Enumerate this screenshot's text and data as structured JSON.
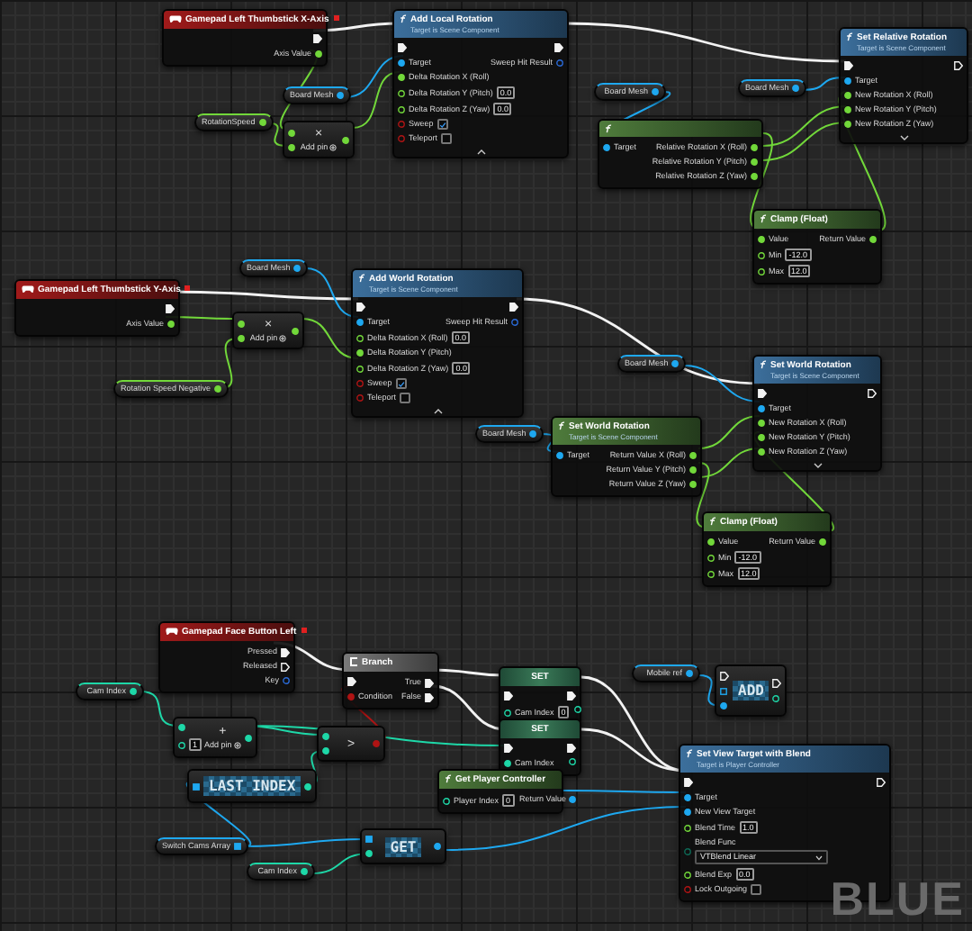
{
  "nodes": [
    {
      "kind": "event",
      "title": "Gamepad Left Thumbstick X-Axis",
      "outputs": [
        {
          "kind": "exec",
          "linked": true
        },
        {
          "kind": "float",
          "label": "Axis Value",
          "linked": true
        }
      ]
    },
    {
      "kind": "variable",
      "title": "Board Mesh",
      "outputs": [
        {
          "kind": "object",
          "linked": true
        }
      ]
    },
    {
      "kind": "variable",
      "title": "RotationSpeed",
      "outputs": [
        {
          "kind": "float",
          "linked": true
        }
      ]
    },
    {
      "kind": "operator",
      "symbol": "×",
      "add_pin": "Add pin",
      "inputs": [
        {
          "kind": "float",
          "linked": true
        },
        {
          "kind": "float",
          "linked": true
        }
      ],
      "outputs": [
        {
          "kind": "float",
          "linked": true
        }
      ]
    },
    {
      "kind": "function",
      "title": "Add Local Rotation",
      "subtitle": "Target is Scene Component",
      "expanded": true,
      "inputs": [
        {
          "kind": "exec",
          "linked": true
        },
        {
          "kind": "object",
          "label": "Target",
          "linked": true
        },
        {
          "kind": "float",
          "label": "Delta Rotation X (Roll)",
          "linked": true
        },
        {
          "kind": "float",
          "label": "Delta Rotation Y (Pitch)",
          "linked": false,
          "value": "0.0"
        },
        {
          "kind": "float",
          "label": "Delta Rotation Z (Yaw)",
          "linked": false,
          "value": "0.0"
        },
        {
          "kind": "bool",
          "label": "Sweep",
          "linked": false,
          "checked": true
        },
        {
          "kind": "bool",
          "label": "Teleport",
          "linked": false,
          "checked": false
        }
      ],
      "outputs": [
        {
          "kind": "exec",
          "linked": true
        },
        {
          "kind": "struct",
          "label": "Sweep Hit Result",
          "linked": false
        }
      ]
    },
    {
      "kind": "variable",
      "title": "Board Mesh",
      "outputs": [
        {
          "kind": "object",
          "linked": true
        }
      ]
    },
    {
      "kind": "variable",
      "title": "Board Mesh",
      "outputs": [
        {
          "kind": "object",
          "linked": true
        }
      ]
    },
    {
      "kind": "pure",
      "inputs": [
        {
          "kind": "object",
          "label": "Target",
          "linked": true
        }
      ],
      "outputs": [
        {
          "kind": "float",
          "label": "Relative Rotation X (Roll)",
          "linked": true
        },
        {
          "kind": "float",
          "label": "Relative Rotation Y (Pitch)",
          "linked": true
        },
        {
          "kind": "float",
          "label": "Relative Rotation Z (Yaw)",
          "linked": true
        }
      ]
    },
    {
      "kind": "function",
      "title": "Set Relative Rotation",
      "subtitle": "Target is Scene Component",
      "expanded": false,
      "inputs": [
        {
          "kind": "exec",
          "linked": true
        },
        {
          "kind": "object",
          "label": "Target",
          "linked": true
        },
        {
          "kind": "float",
          "label": "New Rotation X (Roll)",
          "linked": true
        },
        {
          "kind": "float",
          "label": "New Rotation Y (Pitch)",
          "linked": true
        },
        {
          "kind": "float",
          "label": "New Rotation Z (Yaw)",
          "linked": true
        }
      ],
      "outputs": [
        {
          "kind": "exec",
          "linked": false
        }
      ]
    },
    {
      "kind": "pure",
      "title": "Clamp (Float)",
      "inputs": [
        {
          "kind": "float",
          "label": "Value",
          "linked": true
        },
        {
          "kind": "float",
          "label": "Min",
          "linked": false,
          "value": "-12.0"
        },
        {
          "kind": "float",
          "label": "Max",
          "linked": false,
          "value": "12.0"
        }
      ],
      "outputs": [
        {
          "kind": "float",
          "label": "Return Value",
          "linked": true
        }
      ]
    },
    {
      "kind": "event",
      "title": "Gamepad Left Thumbstick Y-Axis",
      "outputs": [
        {
          "kind": "exec",
          "linked": true
        },
        {
          "kind": "float",
          "label": "Axis Value",
          "linked": true
        }
      ]
    },
    {
      "kind": "variable",
      "title": "Board Mesh",
      "outputs": [
        {
          "kind": "object",
          "linked": true
        }
      ]
    },
    {
      "kind": "operator",
      "symbol": "×",
      "add_pin": "Add pin",
      "inputs": [
        {
          "kind": "float",
          "linked": true
        },
        {
          "kind": "float",
          "linked": true
        }
      ],
      "outputs": [
        {
          "kind": "float",
          "linked": true
        }
      ]
    },
    {
      "kind": "variable",
      "title": "Rotation Speed Negative",
      "outputs": [
        {
          "kind": "float",
          "linked": true
        }
      ]
    },
    {
      "kind": "function",
      "title": "Add World Rotation",
      "subtitle": "Target is Scene Component",
      "expanded": true,
      "inputs": [
        {
          "kind": "exec",
          "linked": true
        },
        {
          "kind": "object",
          "label": "Target",
          "linked": true
        },
        {
          "kind": "float",
          "label": "Delta Rotation X (Roll)",
          "linked": false,
          "value": "0.0"
        },
        {
          "kind": "float",
          "label": "Delta Rotation Y (Pitch)",
          "linked": true
        },
        {
          "kind": "float",
          "label": "Delta Rotation Z (Yaw)",
          "linked": false,
          "value": "0.0"
        },
        {
          "kind": "bool",
          "label": "Sweep",
          "linked": false,
          "checked": true
        },
        {
          "kind": "bool",
          "label": "Teleport",
          "linked": false,
          "checked": false
        }
      ],
      "outputs": [
        {
          "kind": "exec",
          "linked": true
        },
        {
          "kind": "struct",
          "label": "Sweep Hit Result",
          "linked": false
        }
      ]
    },
    {
      "kind": "variable",
      "title": "Board Mesh",
      "outputs": [
        {
          "kind": "object",
          "linked": true
        }
      ]
    },
    {
      "kind": "variable",
      "title": "Board Mesh",
      "outputs": [
        {
          "kind": "object",
          "linked": true
        }
      ]
    },
    {
      "kind": "pure",
      "title": "Set World Rotation",
      "subtitle": "Target is Scene Component",
      "inputs": [
        {
          "kind": "object",
          "label": "Target",
          "linked": true
        }
      ],
      "outputs": [
        {
          "kind": "float",
          "label": "Return Value X (Roll)",
          "linked": true
        },
        {
          "kind": "float",
          "label": "Return Value Y (Pitch)",
          "linked": true
        },
        {
          "kind": "float",
          "label": "Return Value Z (Yaw)",
          "linked": true
        }
      ]
    },
    {
      "kind": "function",
      "title": "Set World Rotation",
      "subtitle": "Target is Scene Component",
      "expanded": false,
      "inputs": [
        {
          "kind": "exec",
          "linked": true
        },
        {
          "kind": "object",
          "label": "Target",
          "linked": true
        },
        {
          "kind": "float",
          "label": "New Rotation X (Roll)",
          "linked": true
        },
        {
          "kind": "float",
          "label": "New Rotation Y (Pitch)",
          "linked": true
        },
        {
          "kind": "float",
          "label": "New Rotation Z (Yaw)",
          "linked": true
        }
      ],
      "outputs": [
        {
          "kind": "exec",
          "linked": false
        }
      ]
    },
    {
      "kind": "pure",
      "title": "Clamp (Float)",
      "inputs": [
        {
          "kind": "float",
          "label": "Value",
          "linked": true
        },
        {
          "kind": "float",
          "label": "Min",
          "linked": false,
          "value": "-12.0"
        },
        {
          "kind": "float",
          "label": "Max",
          "linked": false,
          "value": "12.0"
        }
      ],
      "outputs": [
        {
          "kind": "float",
          "label": "Return Value",
          "linked": true
        }
      ]
    },
    {
      "kind": "event",
      "title": "Gamepad Face Button Left",
      "outputs": [
        {
          "kind": "exec",
          "label": "Pressed",
          "linked": true
        },
        {
          "kind": "exec",
          "label": "Released",
          "linked": false
        },
        {
          "kind": "struct",
          "label": "Key",
          "linked": false
        }
      ]
    },
    {
      "kind": "flow",
      "title": "Branch",
      "inputs": [
        {
          "kind": "exec",
          "linked": true
        },
        {
          "kind": "bool",
          "label": "Condition",
          "linked": true
        }
      ],
      "outputs": [
        {
          "kind": "exec",
          "label": "True",
          "linked": true
        },
        {
          "kind": "exec",
          "label": "False",
          "linked": true
        }
      ]
    },
    {
      "kind": "variable",
      "title": "Cam Index",
      "outputs": [
        {
          "kind": "int",
          "linked": true
        }
      ]
    },
    {
      "kind": "operator",
      "symbol": "+",
      "add_pin": "Add pin",
      "inputs": [
        {
          "kind": "int",
          "linked": true
        },
        {
          "kind": "int",
          "linked": false,
          "value": "1"
        }
      ],
      "outputs": [
        {
          "kind": "int",
          "linked": true
        }
      ]
    },
    {
      "kind": "operator",
      "symbol": ">",
      "inputs": [
        {
          "kind": "int",
          "linked": true
        },
        {
          "kind": "int",
          "linked": true
        }
      ],
      "outputs": [
        {
          "kind": "bool",
          "linked": true
        }
      ]
    },
    {
      "kind": "macro",
      "symbol": "LAST INDEX",
      "inputs": [
        {
          "kind": "array",
          "linked": true
        }
      ],
      "outputs": [
        {
          "kind": "int",
          "linked": true
        }
      ]
    },
    {
      "kind": "variable",
      "title": "Switch Cams Array",
      "outputs": [
        {
          "kind": "array",
          "linked": true
        }
      ]
    },
    {
      "kind": "macro",
      "symbol": "GET",
      "inputs": [
        {
          "kind": "array",
          "linked": true
        },
        {
          "kind": "int",
          "linked": true
        }
      ],
      "outputs": [
        {
          "kind": "object",
          "linked": true
        }
      ]
    },
    {
      "kind": "variable",
      "title": "Cam Index",
      "outputs": [
        {
          "kind": "int",
          "linked": true
        }
      ]
    },
    {
      "kind": "set",
      "title": "SET",
      "inputs": [
        {
          "kind": "exec",
          "linked": true
        },
        {
          "kind": "int",
          "label": "Cam Index",
          "linked": false,
          "value": "0"
        }
      ],
      "outputs": [
        {
          "kind": "exec",
          "linked": true
        },
        {
          "kind": "int",
          "linked": false
        }
      ]
    },
    {
      "kind": "set",
      "title": "SET",
      "inputs": [
        {
          "kind": "exec",
          "linked": true
        },
        {
          "kind": "int",
          "label": "Cam Index",
          "linked": true
        }
      ],
      "outputs": [
        {
          "kind": "exec",
          "linked": true
        },
        {
          "kind": "int",
          "linked": false
        }
      ]
    },
    {
      "kind": "variable",
      "title": "Mobile ref",
      "outputs": [
        {
          "kind": "object",
          "linked": true
        }
      ]
    },
    {
      "kind": "macro",
      "symbol": "ADD",
      "inputs": [
        {
          "kind": "exec",
          "linked": false
        },
        {
          "kind": "array",
          "linked": false
        },
        {
          "kind": "object",
          "linked": true
        }
      ],
      "outputs": [
        {
          "kind": "exec",
          "linked": false
        },
        {
          "kind": "int",
          "linked": false
        }
      ]
    },
    {
      "kind": "pure",
      "title": "Get Player Controller",
      "inputs": [
        {
          "kind": "int",
          "label": "Player Index",
          "linked": false,
          "value": "0"
        }
      ],
      "outputs": [
        {
          "kind": "object",
          "label": "Return Value",
          "linked": true
        }
      ]
    },
    {
      "kind": "function",
      "title": "Set View Target with Blend",
      "subtitle": "Target is Player Controller",
      "inputs": [
        {
          "kind": "exec",
          "linked": true
        },
        {
          "kind": "object",
          "label": "Target",
          "linked": true
        },
        {
          "kind": "object",
          "label": "New View Target",
          "linked": true
        },
        {
          "kind": "float",
          "label": "Blend Time",
          "linked": false,
          "value": "1.0"
        },
        {
          "kind": "enum",
          "label": "Blend Func",
          "linked": false,
          "value": "VTBlend Linear"
        },
        {
          "kind": "float",
          "label": "Blend Exp",
          "linked": false,
          "value": "0.0"
        },
        {
          "kind": "bool",
          "label": "Lock Outgoing",
          "linked": false,
          "checked": false
        }
      ],
      "outputs": [
        {
          "kind": "exec",
          "linked": false
        }
      ]
    }
  ],
  "graph_label": "BLUE"
}
